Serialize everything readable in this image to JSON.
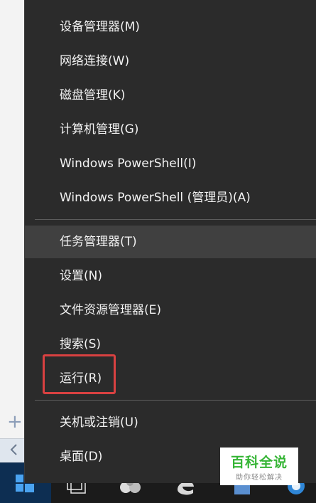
{
  "menu": {
    "items": [
      {
        "label": "设备管理器(M)"
      },
      {
        "label": "网络连接(W)"
      },
      {
        "label": "磁盘管理(K)"
      },
      {
        "label": "计算机管理(G)"
      },
      {
        "label": "Windows PowerShell(I)"
      },
      {
        "label": "Windows PowerShell (管理员)(A)"
      },
      {
        "label": "任务管理器(T)"
      },
      {
        "label": "设置(N)"
      },
      {
        "label": "文件资源管理器(E)"
      },
      {
        "label": "搜索(S)"
      },
      {
        "label": "运行(R)"
      },
      {
        "label": "关机或注销(U)"
      },
      {
        "label": "桌面(D)"
      }
    ],
    "highlighted_item": "任务管理器(T)",
    "boxed_item": "运行(R)"
  },
  "watermark": {
    "title": "百科全说",
    "subtitle": "助你轻松解决"
  },
  "taskbar": {
    "icons": [
      "windows-logo-icon",
      "task-view-icon",
      "app-icon",
      "edge-icon",
      "store-icon",
      "browser-icon"
    ]
  },
  "colors": {
    "menu_background": "#2b2b2b",
    "menu_highlight": "#404040",
    "annotation_box": "#d94141",
    "watermark_green": "#35b535"
  }
}
